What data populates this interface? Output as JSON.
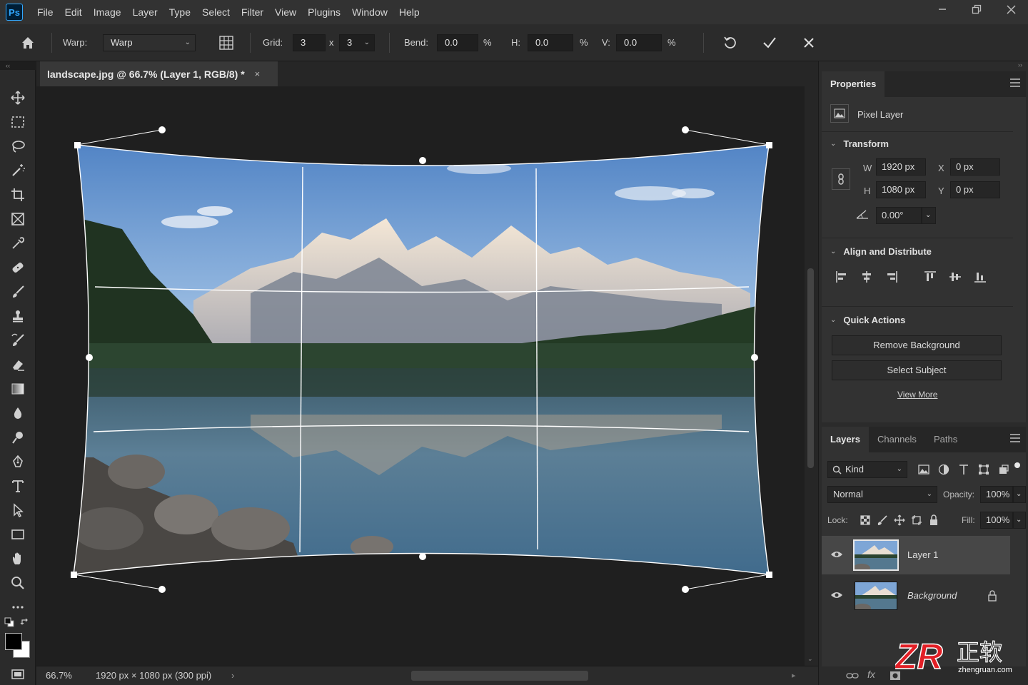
{
  "app": {
    "logo": "Ps"
  },
  "menu": [
    "File",
    "Edit",
    "Image",
    "Layer",
    "Type",
    "Select",
    "Filter",
    "View",
    "Plugins",
    "Window",
    "Help"
  ],
  "window_controls": {
    "minimize": "minimize-icon",
    "restore": "restore-icon",
    "close": "close-icon"
  },
  "options": {
    "warp_label": "Warp:",
    "warp_value": "Warp",
    "grid_label": "Grid:",
    "grid_cols": "3",
    "grid_x": "x",
    "grid_rows": "3",
    "bend_label": "Bend:",
    "bend_value": "0.0",
    "bend_unit": "%",
    "h_label": "H:",
    "h_value": "0.0",
    "h_unit": "%",
    "v_label": "V:",
    "v_value": "0.0",
    "v_unit": "%"
  },
  "document": {
    "tab_title": "landscape.jpg @ 66.7% (Layer 1, RGB/8) *",
    "tab_close": "×"
  },
  "status": {
    "zoom": "66.7%",
    "doc_info": "1920 px × 1080 px (300 ppi)",
    "arrow": "›"
  },
  "properties": {
    "tab": "Properties",
    "layer_type": "Pixel Layer",
    "transform": {
      "title": "Transform",
      "w_label": "W",
      "w_value": "1920 px",
      "h_label": "H",
      "h_value": "1080 px",
      "x_label": "X",
      "x_value": "0 px",
      "y_label": "Y",
      "y_value": "0 px",
      "angle_value": "0.00°"
    },
    "align": {
      "title": "Align and Distribute"
    },
    "quick_actions": {
      "title": "Quick Actions",
      "remove_bg": "Remove Background",
      "select_subject": "Select Subject",
      "view_more": "View More"
    }
  },
  "layers_panel": {
    "tabs": [
      "Layers",
      "Channels",
      "Paths"
    ],
    "filter_kind": "Kind",
    "blend_mode": "Normal",
    "opacity_label": "Opacity:",
    "opacity_value": "100%",
    "lock_label": "Lock:",
    "fill_label": "Fill:",
    "fill_value": "100%",
    "layers": [
      {
        "name": "Layer 1",
        "selected": true
      },
      {
        "name": "Background",
        "locked": true
      }
    ]
  },
  "watermark": {
    "brand": "ZR",
    "cn": "正软",
    "url": "zhengruan.com"
  },
  "colors": {
    "accent": "#31a8ff",
    "panel": "#323232",
    "selected_layer": "#474747"
  }
}
